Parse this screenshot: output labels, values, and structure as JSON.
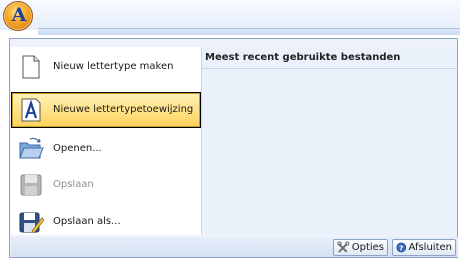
{
  "app": {
    "button_icon": "font-a-app-icon",
    "letter": "A"
  },
  "menu": {
    "items": [
      {
        "label": "Nieuw lettertype maken",
        "icon": "new-document-icon",
        "state": "normal"
      },
      {
        "label": "Nieuwe lettertypetoewijzing",
        "icon": "font-assignment-icon",
        "state": "highlighted"
      },
      {
        "label": "Openen...",
        "icon": "open-folder-icon",
        "state": "normal"
      },
      {
        "label": "Opslaan",
        "icon": "save-disk-icon",
        "state": "disabled"
      },
      {
        "label": "Opslaan als...",
        "icon": "save-as-icon",
        "state": "normal"
      }
    ],
    "recent": {
      "header": "Meest recent gebruikte bestanden"
    },
    "footer": {
      "options_label": "Opties",
      "options_icon": "options-icon",
      "exit_label": "Afsluiten",
      "exit_icon": "exit-icon"
    }
  },
  "colors": {
    "highlight": "#ffd25a",
    "border": "#8ea5c8",
    "recent_bg": "#eaf1fb"
  }
}
